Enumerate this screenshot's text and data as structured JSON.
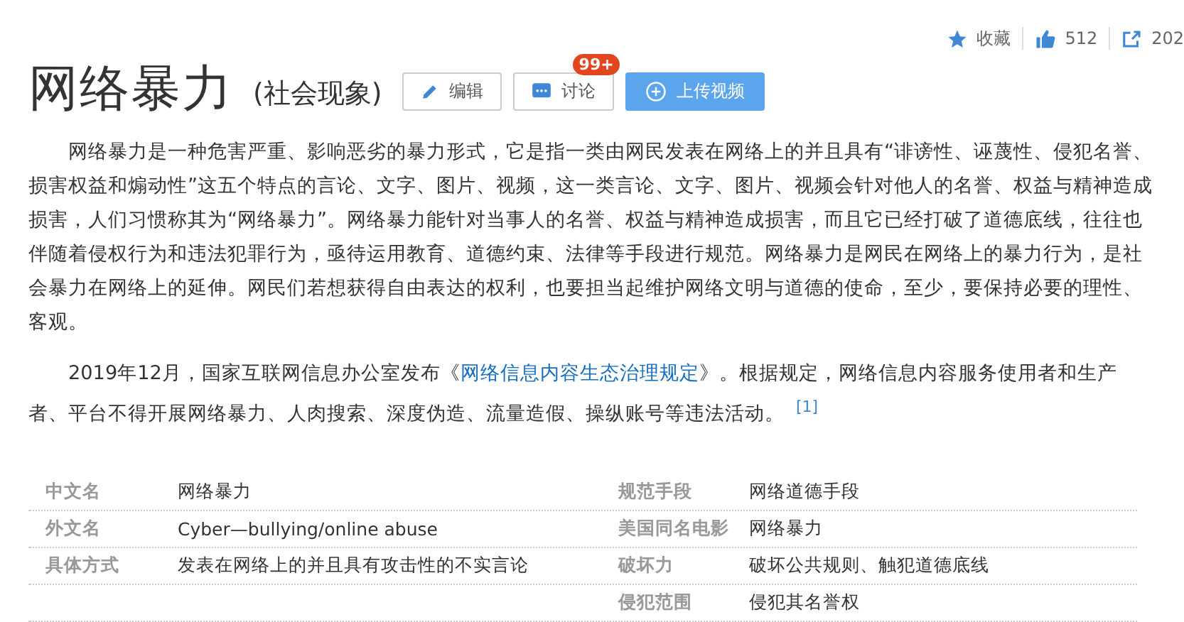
{
  "top_actions": [
    {
      "kind": "favorite",
      "label": "收藏"
    },
    {
      "kind": "like",
      "label": "512"
    },
    {
      "kind": "share",
      "label": "202"
    }
  ],
  "title": "网络暴力",
  "subtitle": "(社会现象)",
  "buttons": [
    {
      "kind": "edit",
      "label": "编辑"
    },
    {
      "kind": "discuss",
      "label": "讨论",
      "badge": "99+"
    },
    {
      "kind": "upload",
      "label": "上传视频"
    }
  ],
  "paragraphs": [
    {
      "parts": [
        {
          "text": "网络暴力是一种危害严重、影响恶劣的暴力形式，它是指一类由网民发表在网络上的并且具有“诽谤性、诬蔑性、侵犯名誉、损害权益和煽动性”这五个特点的言论、文字、图片、视频，这一类言论、文字、图片、视频会针对他人的名誉、权益与精神造成损害，人们习惯称其为“网络暴力”。网络暴力能针对当事人的名誉、权益与精神造成损害，而且它已经打破了道德底线，往往也伴随着侵权行为和违法犯罪行为，亟待运用教育、道德约束、法律等手段进行规范。网络暴力是网民在网络上的暴力行为，是社会暴力在网络上的延伸。网民们若想获得自由表达的权利，也要担当起维护网络文明与道德的使命，至少，要保持必要的理性、客观。",
          "link": false
        }
      ]
    },
    {
      "parts": [
        {
          "text": "2019年12月，国家互联网信息办公室发布《",
          "link": false
        },
        {
          "text": "网络信息内容生态治理规定",
          "link": true
        },
        {
          "text": "》。根据规定，网络信息内容服务使用者和生产者、平台不得开展网络暴力、人肉搜索、深度伪造、流量造假、操纵账号等违法活动。",
          "link": false
        }
      ],
      "ref": "[1]"
    }
  ],
  "info_left": [
    {
      "label": "中文名",
      "value": "网络暴力"
    },
    {
      "label": "外文名",
      "value": "Cyber—bullying/online abuse"
    },
    {
      "label": "具体方式",
      "value": "发表在网络上的并且具有攻击性的不实言论"
    }
  ],
  "info_right": [
    {
      "label": "规范手段",
      "value": "网络道德手段"
    },
    {
      "label": "美国同名电影",
      "value": "网络暴力"
    },
    {
      "label": "破坏力",
      "value": "破坏公共规则、触犯道德底线"
    },
    {
      "label": "侵犯范围",
      "value": "侵犯其名誉权"
    }
  ]
}
